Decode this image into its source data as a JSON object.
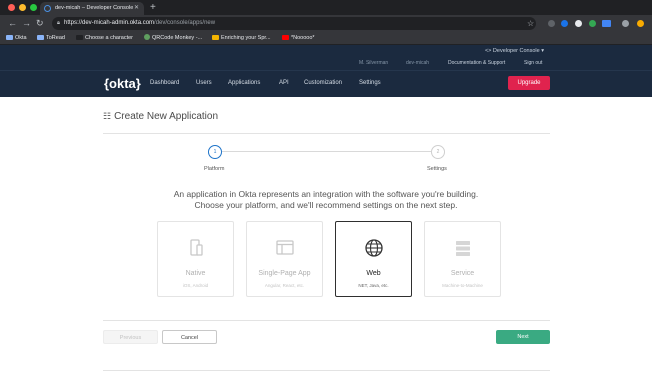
{
  "browser": {
    "tab_title": "dev-micah – Developer Console",
    "url_host": "https://dev-micah-admin.okta.com",
    "url_path": "/dev/console/apps/new",
    "bookmarks": [
      {
        "label": "Okta",
        "color": "#8ab4f8"
      },
      {
        "label": "ToRead",
        "color": "#8ab4f8"
      },
      {
        "label": "Choose a character",
        "color": "#202124"
      },
      {
        "label": "QRCode Monkey -...",
        "color": "#5f9e5f"
      },
      {
        "label": "Enriching your Spr...",
        "color": "#f4b400"
      },
      {
        "label": "*Nooooo*",
        "color": "#ff0000"
      }
    ],
    "colors": {
      "close": "#ff5f57",
      "minimize": "#febc2e",
      "maximize": "#28c840"
    }
  },
  "okta": {
    "developer_console": "<> Developer Console ▾",
    "user": "M. Silverman",
    "org": "dev-micah",
    "docs_link": "Documentation & Support",
    "sign_out": "Sign out",
    "logo": "{okta}",
    "nav": [
      "Dashboard",
      "Users",
      "Applications",
      "API",
      "Customization",
      "Settings"
    ],
    "upgrade": "Upgrade",
    "brand_color": "#e0234e",
    "header_color": "#1b2a3f"
  },
  "page": {
    "title": "Create New Application",
    "steps": [
      {
        "number": "1",
        "label": "Platform",
        "active": true
      },
      {
        "number": "2",
        "label": "Settings",
        "active": false
      }
    ],
    "intro_line1": "An application in Okta represents an integration with the software you're building.",
    "intro_line2": "Choose your platform, and we'll recommend settings on the next step.",
    "platforms": [
      {
        "name": "Native",
        "desc": "iOS, Android",
        "icon": "mobile-icon",
        "selected": false
      },
      {
        "name": "Single-Page App",
        "desc": "Angular, React, etc.",
        "icon": "browser-window-icon",
        "selected": false
      },
      {
        "name": "Web",
        "desc": "NET, Java, etc.",
        "icon": "globe-icon",
        "selected": true
      },
      {
        "name": "Service",
        "desc": "Machine-to-Machine",
        "icon": "server-icon",
        "selected": false
      }
    ],
    "buttons": {
      "previous": "Previous",
      "cancel": "Cancel",
      "next": "Next"
    },
    "accent_step": "#1d73c9",
    "next_color": "#3aaa82"
  }
}
